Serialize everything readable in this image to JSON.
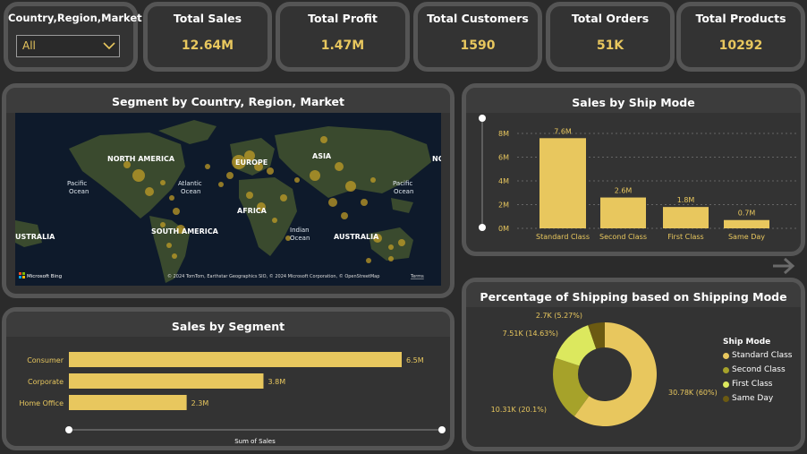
{
  "slicer": {
    "title": "Country,Region,Market",
    "selected": "All"
  },
  "kpis": [
    {
      "title": "Total Sales",
      "value": "12.64M"
    },
    {
      "title": "Total Profit",
      "value": "1.47M"
    },
    {
      "title": "Total Customers",
      "value": "1590"
    },
    {
      "title": "Total Orders",
      "value": "51K"
    },
    {
      "title": "Total Products",
      "value": "10292"
    }
  ],
  "map": {
    "title": "Segment by Country, Region, Market",
    "labels": {
      "north_america": "NORTH AMERICA",
      "europe": "EUROPE",
      "asia": "ASIA",
      "africa": "AFRICA",
      "south_america": "SOUTH AMERICA",
      "australia": "AUSTRALIA",
      "australia_left": "USTRALIA",
      "pacific_left_1": "Pacific",
      "pacific_left_2": "Ocean",
      "atlantic_1": "Atlantic",
      "atlantic_2": "Ocean",
      "indian_1": "Indian",
      "indian_2": "Ocean",
      "pacific_right_1": "Pacific",
      "pacific_right_2": "Ocean",
      "nor_right": "NOR"
    },
    "brand": "Microsoft Bing",
    "attribution": "© 2024 TomTom, Earthstar Geographics SIO, © 2024 Microsoft Corporation, © OpenStreetMap",
    "terms": "Terms"
  },
  "segment_chart": {
    "title": "Sales by Segment",
    "axis_title": "Sum of Sales"
  },
  "shipmode_chart": {
    "title": "Sales by Ship Mode"
  },
  "donut": {
    "title": "Percentage of Shipping based on Shipping Mode",
    "legend_title": "Ship Mode",
    "labels": {
      "standard": "30.78K (60%)",
      "second": "10.31K (20.1%)",
      "first": "7.51K (14.63%)",
      "same": "2.7K (5.27%)"
    }
  },
  "chart_data": [
    {
      "type": "bar",
      "orientation": "horizontal",
      "title": "Sales by Segment",
      "xlabel": "Sum of Sales",
      "categories": [
        "Consumer",
        "Corporate",
        "Home Office"
      ],
      "values": [
        6.5,
        3.8,
        2.3
      ],
      "value_labels": [
        "6.5M",
        "3.8M",
        "2.3M"
      ],
      "unit": "M",
      "color": "#e8c75e"
    },
    {
      "type": "bar",
      "title": "Sales by Ship Mode",
      "categories": [
        "Standard Class",
        "Second Class",
        "First Class",
        "Same Day"
      ],
      "values": [
        7.6,
        2.6,
        1.8,
        0.7
      ],
      "value_labels": [
        "7.6M",
        "2.6M",
        "1.8M",
        "0.7M"
      ],
      "ylim": [
        0,
        8
      ],
      "ticks": [
        "0M",
        "2M",
        "4M",
        "6M",
        "8M"
      ],
      "grid": true,
      "color": "#e8c75e"
    },
    {
      "type": "pie",
      "title": "Percentage of Shipping based on Shipping Mode",
      "legend_title": "Ship Mode",
      "legend_position": "right",
      "series": [
        {
          "name": "Standard Class",
          "value": 30.78,
          "percent": 60,
          "color": "#e8c75e"
        },
        {
          "name": "Second Class",
          "value": 10.31,
          "percent": 20.1,
          "color": "#a6a22a"
        },
        {
          "name": "First Class",
          "value": 7.51,
          "percent": 14.63,
          "color": "#dce85e"
        },
        {
          "name": "Same Day",
          "value": 2.7,
          "percent": 5.27,
          "color": "#6b5a12"
        }
      ]
    }
  ]
}
